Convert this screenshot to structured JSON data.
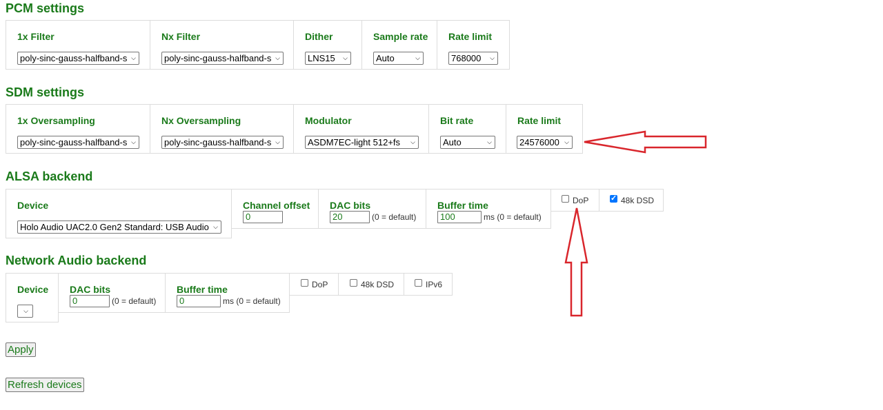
{
  "pcm": {
    "title": "PCM settings",
    "filter1x": {
      "label": "1x Filter",
      "value": "poly-sinc-gauss-halfband-s"
    },
    "filterNx": {
      "label": "Nx Filter",
      "value": "poly-sinc-gauss-halfband-s"
    },
    "dither": {
      "label": "Dither",
      "value": "LNS15"
    },
    "sample_rate": {
      "label": "Sample rate",
      "value": "Auto"
    },
    "rate_limit": {
      "label": "Rate limit",
      "value": "768000"
    }
  },
  "sdm": {
    "title": "SDM settings",
    "oversampling1x": {
      "label": "1x Oversampling",
      "value": "poly-sinc-gauss-halfband-s"
    },
    "oversamplingNx": {
      "label": "Nx Oversampling",
      "value": "poly-sinc-gauss-halfband-s"
    },
    "modulator": {
      "label": "Modulator",
      "value": "ASDM7EC-light 512+fs"
    },
    "bit_rate": {
      "label": "Bit rate",
      "value": "Auto"
    },
    "rate_limit": {
      "label": "Rate limit",
      "value": "24576000"
    }
  },
  "alsa": {
    "title": "ALSA backend",
    "device": {
      "label": "Device",
      "value": "Holo Audio UAC2.0 Gen2 Standard: USB Audio"
    },
    "channel_offset": {
      "label": "Channel offset",
      "value": "0"
    },
    "dac_bits": {
      "label": "DAC bits",
      "value": "20",
      "note": "(0 = default)"
    },
    "buffer_time": {
      "label": "Buffer time",
      "value": "100",
      "note": "ms (0 = default)"
    },
    "dop": {
      "label": "DoP",
      "checked": false
    },
    "dsd48k": {
      "label": "48k DSD",
      "checked": true
    }
  },
  "network": {
    "title": "Network Audio backend",
    "device": {
      "label": "Device",
      "value": ""
    },
    "dac_bits": {
      "label": "DAC bits",
      "value": "0",
      "note": "(0 = default)"
    },
    "buffer_time": {
      "label": "Buffer time",
      "value": "0",
      "note": "ms (0 = default)"
    },
    "dop": {
      "label": "DoP",
      "checked": false
    },
    "dsd48k": {
      "label": "48k DSD",
      "checked": false
    },
    "ipv6": {
      "label": "IPv6",
      "checked": false
    }
  },
  "buttons": {
    "apply": "Apply",
    "refresh": "Refresh devices"
  },
  "colors": {
    "accent": "#1a7a1a",
    "annotation_arrow": "#d9262c",
    "checkbox_checked": "#0075ff"
  }
}
